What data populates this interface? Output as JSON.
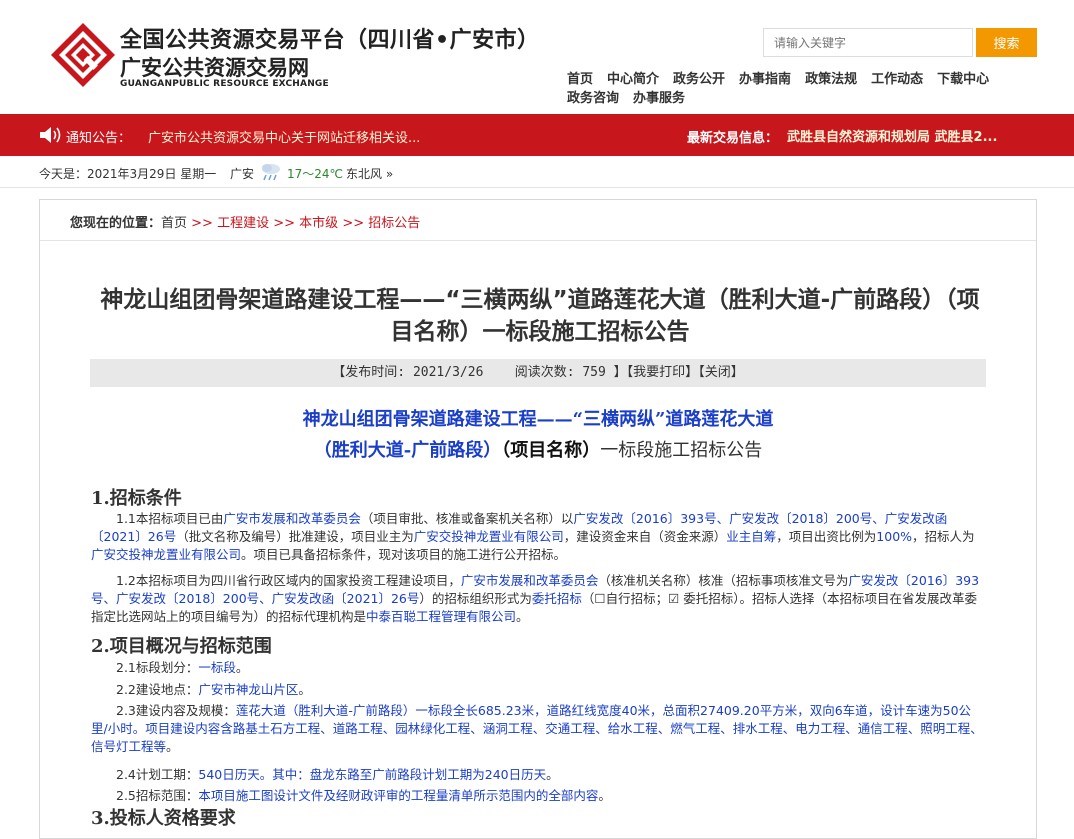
{
  "header": {
    "title1": "全国公共资源交易平台（四川省•广安市）",
    "title2": "广安公共资源交易网",
    "title3": "GUANGANPUBLIC RESOURCE EXCHANGE",
    "search_placeholder": "请输入关键字",
    "search_button": "搜索"
  },
  "nav": [
    "首页",
    "中心简介",
    "政务公开",
    "办事指南",
    "政策法规",
    "工作动态",
    "下载中心",
    "政务咨询",
    "办事服务"
  ],
  "notice": {
    "label": "通知公告：",
    "text": "广安市公共资源交易中心关于网站迁移相关设...",
    "latest_label": "最新交易信息：",
    "latest_text": "武胜县自然资源和规划局 武胜县2..."
  },
  "date_bar": {
    "date": "今天是：2021年3月29日 星期一",
    "city": "广安",
    "temp": "17～24℃",
    "wind": "东北风 »"
  },
  "breadcrumb": {
    "label": "您现在的位置：",
    "home": "首页",
    "sep": " >> ",
    "c1": "工程建设",
    "c2": "本市级",
    "c3": "招标公告"
  },
  "article": {
    "title": "神龙山组团骨架道路建设工程——“三横两纵”道路莲花大道（胜利大道-广前路段）（项目名称）一标段施工招标公告",
    "meta_publish": "【发布时间:  2021/3/26",
    "meta_views": "阅读次数: 759 】",
    "meta_print": "【我要打印】",
    "meta_close": "【关闭】",
    "sub1": "神龙山组团骨架道路建设工程——“三横两纵”道路莲花大道",
    "sub2a": "（胜利大道-广前路段）",
    "sub2b": "（项目名称）",
    "sub2c": "一标段施工招标公告"
  },
  "sections": {
    "s1": "1.招标条件",
    "s2": "2.项目概况与招标范围",
    "s3": "3.投标人资格要求"
  },
  "paragraphs": {
    "p11a": "　　1.1本招标项目已由",
    "p11b": "广安市发展和改革委员会",
    "p11c": "（项目审批、核准或备案机关名称）以",
    "p11d": "广安发改〔2016〕393号、广安发改〔2018〕200号、广安发改函〔2021〕26号",
    "p11e": "（批文名称及编号）批准建设，项目业主为",
    "p11f": "广安交投神龙置业有限公司",
    "p11g": "，建设资金来自（资金来源）",
    "p11h": "业主自筹",
    "p11i": "，项目出资比例为",
    "p11j": "100%",
    "p11k": "，招标人为",
    "p11l": "广安交投神龙置业有限公司",
    "p11m": "。项目已具备招标条件，现对该项目的施工进行公开招标。",
    "p12a": "　　1.2本招标项目为四川省行政区域内的国家投资工程建设项目，",
    "p12b": "广安市发展和改革委员会",
    "p12c": "（核准机关名称）核准（招标事项核准文号为",
    "p12d": "广安发改〔2016〕393号、广安发改〔2018〕200号、广安发改函〔2021〕26号",
    "p12e": "）的招标组织形式为",
    "p12f": "委托招标",
    "p12g": "（☐自行招标；☑ 委托招标）。招标人选择（本招标项目在省发展改革委指定比选网站上的项目编号为）的招标代理机构是",
    "p12h": "中泰百聪工程管理有限公司",
    "p12i": "。",
    "p21a": "　　2.1标段划分：",
    "p21b": "一标段",
    "p21c": "。",
    "p22a": "　　2.2建设地点：",
    "p22b": "广安市神龙山片区",
    "p22c": "。",
    "p23a": "　　2.3建设内容及规模：",
    "p23b": "莲花大道（胜利大道-广前路段）一标段全长685.23米，道路红线宽度40米，总面积27409.20平方米，双向6车道，设计车速为50公里/小时。项目建设内容含路基土石方工程、道路工程、园林绿化工程、涵洞工程、交通工程、给水工程、燃气工程、排水工程、电力工程、通信工程、照明工程、信号灯工程等",
    "p23c": "。",
    "p24a": "　　2.4计划工期：",
    "p24b": "540日历天。其中：盘龙东路至广前路段计划工期为240日历天",
    "p24c": "。",
    "p25a": "　　2.5招标范围：",
    "p25b": "本项目施工图设计文件及经财政评审的工程量清单所示范围内的全部内容",
    "p25c": "。"
  },
  "colors": {
    "brand_red": "#c8161d",
    "search_orange": "#f39800",
    "link_blue": "#1a3ec8"
  }
}
